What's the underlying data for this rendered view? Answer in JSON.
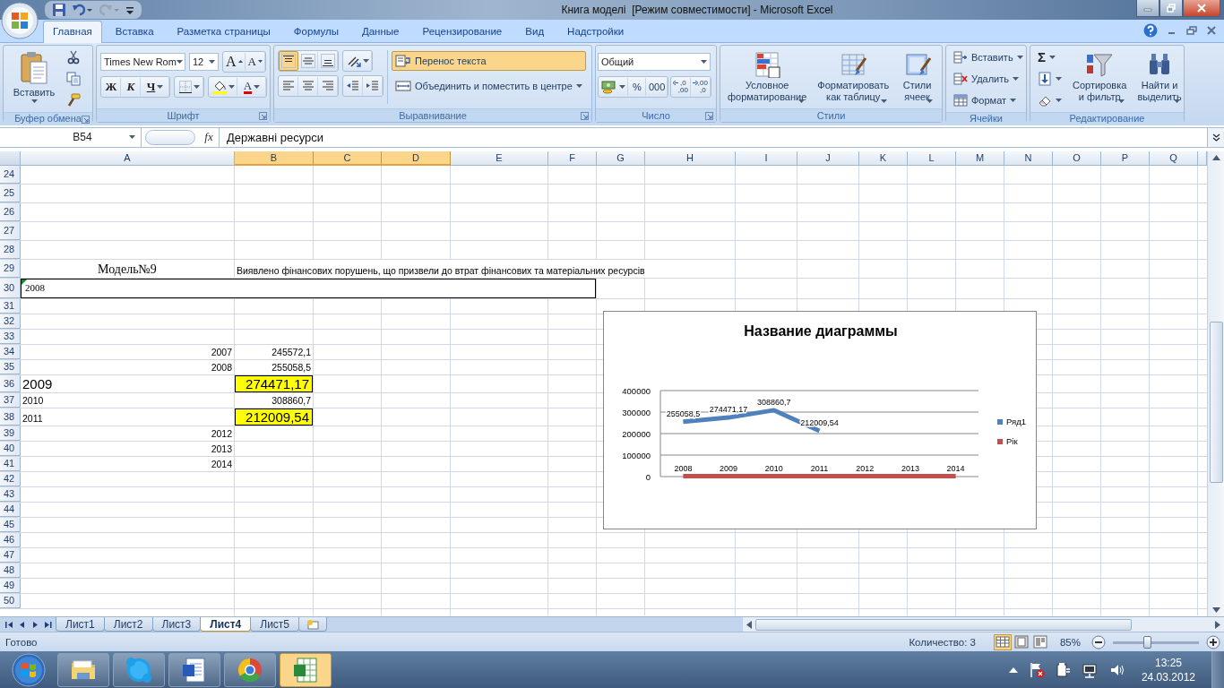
{
  "window": {
    "title": "Книга моделі  [Режим совместимости] - Microsoft Excel"
  },
  "ribbon_tabs": [
    {
      "label": "Главная",
      "selected": true
    },
    {
      "label": "Вставка",
      "selected": false
    },
    {
      "label": "Разметка страницы",
      "selected": false
    },
    {
      "label": "Формулы",
      "selected": false
    },
    {
      "label": "Данные",
      "selected": false
    },
    {
      "label": "Рецензирование",
      "selected": false
    },
    {
      "label": "Вид",
      "selected": false
    },
    {
      "label": "Надстройки",
      "selected": false
    }
  ],
  "ribbon": {
    "clipboard": {
      "label": "Буфер обмена",
      "paste": "Вставить"
    },
    "font": {
      "label": "Шрифт",
      "name": "Times New Rom",
      "size": "12",
      "grow": "A",
      "shrink": "A",
      "bold": "Ж",
      "italic": "К",
      "underline": "Ч",
      "font_color_letter": "A"
    },
    "alignment": {
      "label": "Выравнивание",
      "vertical": [
        {
          "selected": true
        },
        {
          "selected": false
        },
        {
          "selected": false
        }
      ],
      "wrap": {
        "label": "Перенос текста",
        "on": true
      },
      "merge": "Объединить и поместить в центре"
    },
    "number": {
      "label": "Число",
      "format": "Общий",
      "percent": "%",
      "thousands": "000",
      "decimals": [
        {
          "top": ",0",
          "bottom": ",00"
        },
        {
          "top": ",00",
          "bottom": ",0"
        }
      ]
    },
    "styles": {
      "label": "Стили",
      "buttons": [
        "Условное\nформатирование",
        "Форматировать\nкак таблицу",
        "Стили\nячеек"
      ]
    },
    "cells": {
      "label": "Ячейки",
      "buttons": [
        "Вставить",
        "Удалить",
        "Формат"
      ]
    },
    "editing": {
      "label": "Редактирование",
      "sum": "Σ",
      "sort": "Сортировка\nи фильтр",
      "find": "Найти и\nвыделить"
    }
  },
  "formula_bar": {
    "name_box": "B54",
    "function_label": "fx",
    "value": "Державні ресурси"
  },
  "sheet": {
    "columns": [
      {
        "label": "A",
        "selected": false
      },
      {
        "label": "B",
        "selected": true
      },
      {
        "label": "C",
        "selected": true
      },
      {
        "label": "D",
        "selected": true
      },
      {
        "label": "E",
        "selected": false
      },
      {
        "label": "F",
        "selected": false
      },
      {
        "label": "G",
        "selected": false
      },
      {
        "label": "H",
        "selected": false
      },
      {
        "label": "I",
        "selected": false
      },
      {
        "label": "J",
        "selected": false
      },
      {
        "label": "K",
        "selected": false
      },
      {
        "label": "L",
        "selected": false
      },
      {
        "label": "M",
        "selected": false
      },
      {
        "label": "N",
        "selected": false
      },
      {
        "label": "O",
        "selected": false
      },
      {
        "label": "P",
        "selected": false
      },
      {
        "label": "Q",
        "selected": false
      }
    ],
    "rows": [
      {
        "number": "24"
      },
      {
        "number": "25"
      },
      {
        "number": "26"
      },
      {
        "number": "27"
      },
      {
        "number": "28"
      },
      {
        "number": "29",
        "a": {
          "text": "Модель№9",
          "kind": "title"
        },
        "b": {
          "text": "Виявлено фінансових порушень, що призвели до втрат фінансових та матеріальних ресурсів",
          "kind": "note"
        }
      },
      {
        "number": "30",
        "a": {
          "text": "2008",
          "kind": "box",
          "error_flag": true
        }
      },
      {
        "number": "31"
      },
      {
        "number": "32"
      },
      {
        "number": "33"
      },
      {
        "number": "34",
        "a": {
          "text": "2007",
          "kind": "number"
        },
        "b": {
          "text": "245572,1",
          "kind": "number"
        }
      },
      {
        "number": "35",
        "a": {
          "text": "2008",
          "kind": "number"
        },
        "b": {
          "text": "255058,5",
          "kind": "number"
        }
      },
      {
        "number": "36",
        "a": {
          "text": "2009",
          "kind": "big"
        },
        "b": {
          "text": "274471,17",
          "kind": "mark"
        }
      },
      {
        "number": "37",
        "a": {
          "text": "2010",
          "kind": "label"
        },
        "b": {
          "text": "308860,7",
          "kind": "number"
        }
      },
      {
        "number": "38",
        "a": {
          "text": "2011",
          "kind": "label"
        },
        "b": {
          "text": "212009,54",
          "kind": "mark"
        }
      },
      {
        "number": "39",
        "a": {
          "text": "2012",
          "kind": "number"
        }
      },
      {
        "number": "40",
        "a": {
          "text": "2013",
          "kind": "number"
        }
      },
      {
        "number": "41",
        "a": {
          "text": "2014",
          "kind": "number"
        }
      },
      {
        "number": "42"
      },
      {
        "number": "43"
      },
      {
        "number": "44"
      },
      {
        "number": "45"
      },
      {
        "number": "46"
      },
      {
        "number": "47"
      },
      {
        "number": "48"
      },
      {
        "number": "49"
      },
      {
        "number": "50"
      }
    ]
  },
  "chart": {
    "chart_data": {
      "type": "line",
      "title": "Название диаграммы",
      "ylim": [
        0,
        400000
      ],
      "yticks": [
        0,
        100000,
        200000,
        300000,
        400000
      ],
      "grid": true,
      "data_labels": true,
      "legend": "right",
      "series": [
        {
          "name": "Ряд1",
          "color": "#4f81bd",
          "values": [
            255058.5,
            274471.17,
            308860.7,
            212009.54,
            null,
            null,
            null
          ],
          "value_labels": [
            "255058,5",
            "274471,17",
            "308860,7",
            "212009,54",
            null,
            null,
            null
          ]
        },
        {
          "name": "Рік",
          "color": "#c0504d",
          "values": [
            2008,
            2009,
            2010,
            2011,
            2012,
            2013,
            2014
          ],
          "value_labels": [
            "2008",
            "2009",
            "2010",
            "2011",
            "2012",
            "2013",
            "2014"
          ]
        }
      ]
    }
  },
  "sheet_tabs": [
    {
      "label": "Лист1",
      "selected": false
    },
    {
      "label": "Лист2",
      "selected": false
    },
    {
      "label": "Лист3",
      "selected": false
    },
    {
      "label": "Лист4",
      "selected": true
    },
    {
      "label": "Лист5",
      "selected": false
    }
  ],
  "status_bar": {
    "status": "Готово",
    "count": "Количество: 3",
    "views": [
      {
        "selected": true
      },
      {
        "selected": false
      },
      {
        "selected": false
      }
    ],
    "zoom": "85%",
    "zoom_slider": {
      "level": 0.4
    }
  },
  "taskbar": {
    "apps": [
      {
        "selected": false
      },
      {
        "selected": false
      },
      {
        "selected": false
      },
      {
        "selected": false
      },
      {
        "selected": true
      }
    ],
    "time": "13:25",
    "date": "24.03.2012"
  }
}
